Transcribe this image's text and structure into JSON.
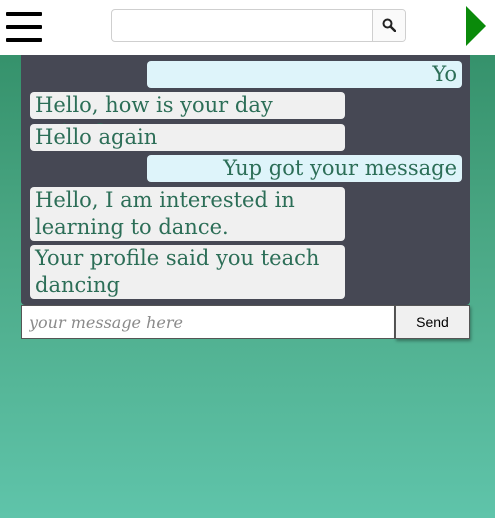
{
  "header": {
    "menu_icon": "hamburger-menu-icon",
    "search": {
      "value": "",
      "placeholder": "",
      "button_icon": "search-icon"
    },
    "forward_icon": "play-arrow-icon",
    "accent_color": "#0a8a0a"
  },
  "chat": {
    "messages": [
      {
        "sender": "me",
        "text": "Yo"
      },
      {
        "sender": "them",
        "text": "Hello, how is your day going?"
      },
      {
        "sender": "them",
        "text": "Hello again"
      },
      {
        "sender": "me",
        "text": "Yup got your message"
      },
      {
        "sender": "them",
        "text": "Hello, I am interested in learning to dance."
      },
      {
        "sender": "them",
        "text": "Your profile said you teach dancing"
      }
    ],
    "composer": {
      "placeholder": "your message here",
      "value": "",
      "send_label": "Send"
    },
    "colors": {
      "panel": "#464854",
      "my_bubble": "#def4fa",
      "their_bubble": "#f0f0f0",
      "text": "#2c6e57"
    }
  }
}
